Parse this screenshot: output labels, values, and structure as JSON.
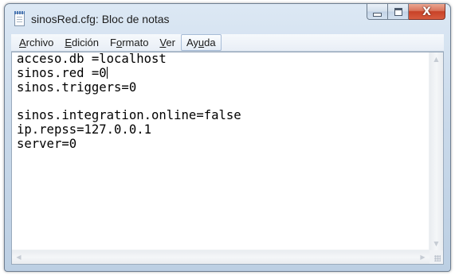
{
  "window": {
    "title": "sinosRed.cfg: Bloc de notas",
    "close_glyph": "X"
  },
  "menubar": {
    "items": [
      {
        "prefix": "",
        "accel": "A",
        "suffix": "rchivo"
      },
      {
        "prefix": "",
        "accel": "E",
        "suffix": "dición"
      },
      {
        "prefix": "F",
        "accel": "o",
        "suffix": "rmato"
      },
      {
        "prefix": "",
        "accel": "V",
        "suffix": "er"
      },
      {
        "prefix": "Ay",
        "accel": "u",
        "suffix": "da"
      }
    ]
  },
  "editor": {
    "lines": [
      "acceso.db =localhost",
      "sinos.red =0",
      "sinos.triggers=0",
      "",
      "sinos.integration.online=false",
      "ip.repss=127.0.0.1",
      "server=0"
    ]
  },
  "scrollbars": {
    "up_glyph": "▲",
    "down_glyph": "▼",
    "left_glyph": "◀",
    "right_glyph": "▶"
  },
  "colors": {
    "title_bar": "#c9d9ea",
    "close_button": "#c84227",
    "editor_background": "#ffffff"
  },
  "icons": {
    "app": "notepad-icon",
    "minimize": "minimize-icon",
    "maximize": "maximize-icon",
    "close": "close-icon"
  }
}
